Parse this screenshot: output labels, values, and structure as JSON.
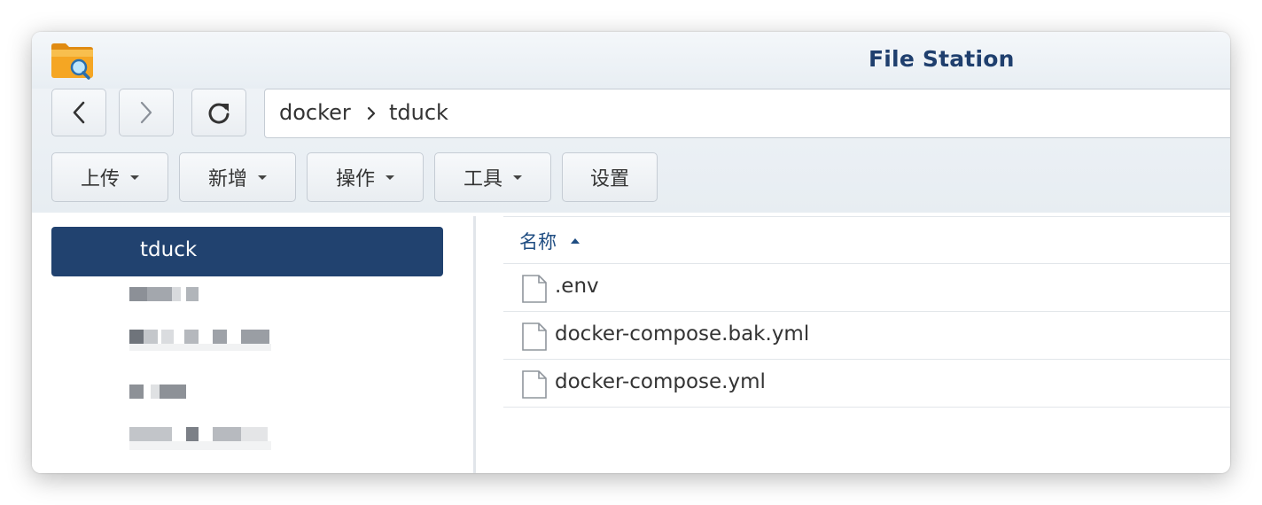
{
  "window": {
    "title": "File Station"
  },
  "icons": {
    "app": "folder-with-magnifier-icon",
    "back": "chevron-left-icon",
    "forward": "chevron-right-icon",
    "refresh": "refresh-icon",
    "path_separator": "chevron-right-icon",
    "dropdown": "caret-down-icon",
    "file": "file-icon",
    "sort": "sort-ascending-icon"
  },
  "path": {
    "crumbs": [
      "docker",
      "tduck"
    ]
  },
  "toolbar": {
    "upload_label": "上传",
    "create_label": "新增",
    "action_label": "操作",
    "tools_label": "工具",
    "settings_label": "设置"
  },
  "sidebar": {
    "selected_label": "tduck"
  },
  "file_list": {
    "columns": [
      {
        "label": "名称",
        "sort": "ascending"
      }
    ],
    "rows": [
      {
        "name": ".env"
      },
      {
        "name": "docker-compose.bak.yml"
      },
      {
        "name": "docker-compose.yml"
      }
    ]
  },
  "colors": {
    "accent": "#21426f",
    "title": "#1f3f6e",
    "header_link": "#1f4d82"
  }
}
